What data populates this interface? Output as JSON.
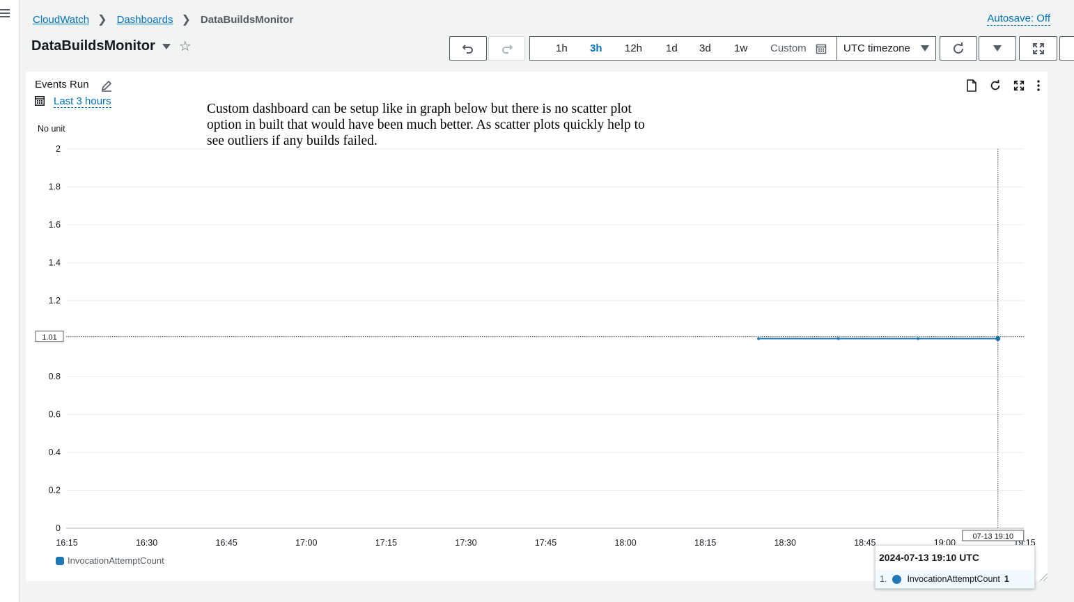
{
  "breadcrumb": {
    "items": [
      "CloudWatch",
      "Dashboards"
    ],
    "current": "DataBuildsMonitor"
  },
  "autosave_label": "Autosave: Off",
  "page_title": "DataBuildsMonitor",
  "toolbar": {
    "ranges": [
      "1h",
      "3h",
      "12h",
      "1d",
      "3d",
      "1w"
    ],
    "active_range": "3h",
    "custom_label": "Custom",
    "timezone_label": "UTC timezone"
  },
  "widget": {
    "title": "Events Run",
    "period_label": "Last 3 hours",
    "annotation": "Custom dashboard can be setup like in graph below but there is no scatter plot option in built that would have been much better. As scatter plots quickly help to see outliers if any builds failed."
  },
  "chart_data": {
    "type": "line",
    "ylabel": "No unit",
    "ylim": [
      0,
      2
    ],
    "yticks": [
      "2",
      "1.8",
      "1.6",
      "1.4",
      "1.2",
      "0.8",
      "0.6",
      "0.4",
      "0.2",
      "0"
    ],
    "ytick_values": [
      2,
      1.8,
      1.6,
      1.4,
      1.2,
      0.8,
      0.6,
      0.4,
      0.2,
      0
    ],
    "crosshair_y_label": "1.01",
    "crosshair_y_value": 1.01,
    "xticks": [
      "16:15",
      "16:30",
      "16:45",
      "17:00",
      "17:15",
      "17:30",
      "17:45",
      "18:00",
      "18:15",
      "18:30",
      "18:45",
      "19:00",
      "19:15"
    ],
    "x_range": [
      "16:15",
      "19:15"
    ],
    "crosshair_x_label": "07-13 19:10",
    "series": [
      {
        "name": "InvocationAttemptCount",
        "color": "#1f77b4",
        "x": [
          "18:25",
          "18:40",
          "18:55",
          "19:10"
        ],
        "y": [
          1,
          1,
          1,
          1
        ]
      }
    ],
    "legend_position": "bottom-left",
    "grid": true
  },
  "tooltip": {
    "title": "2024-07-13 19:10 UTC",
    "index": "1.",
    "series_name": "InvocationAttemptCount",
    "value": "1"
  }
}
